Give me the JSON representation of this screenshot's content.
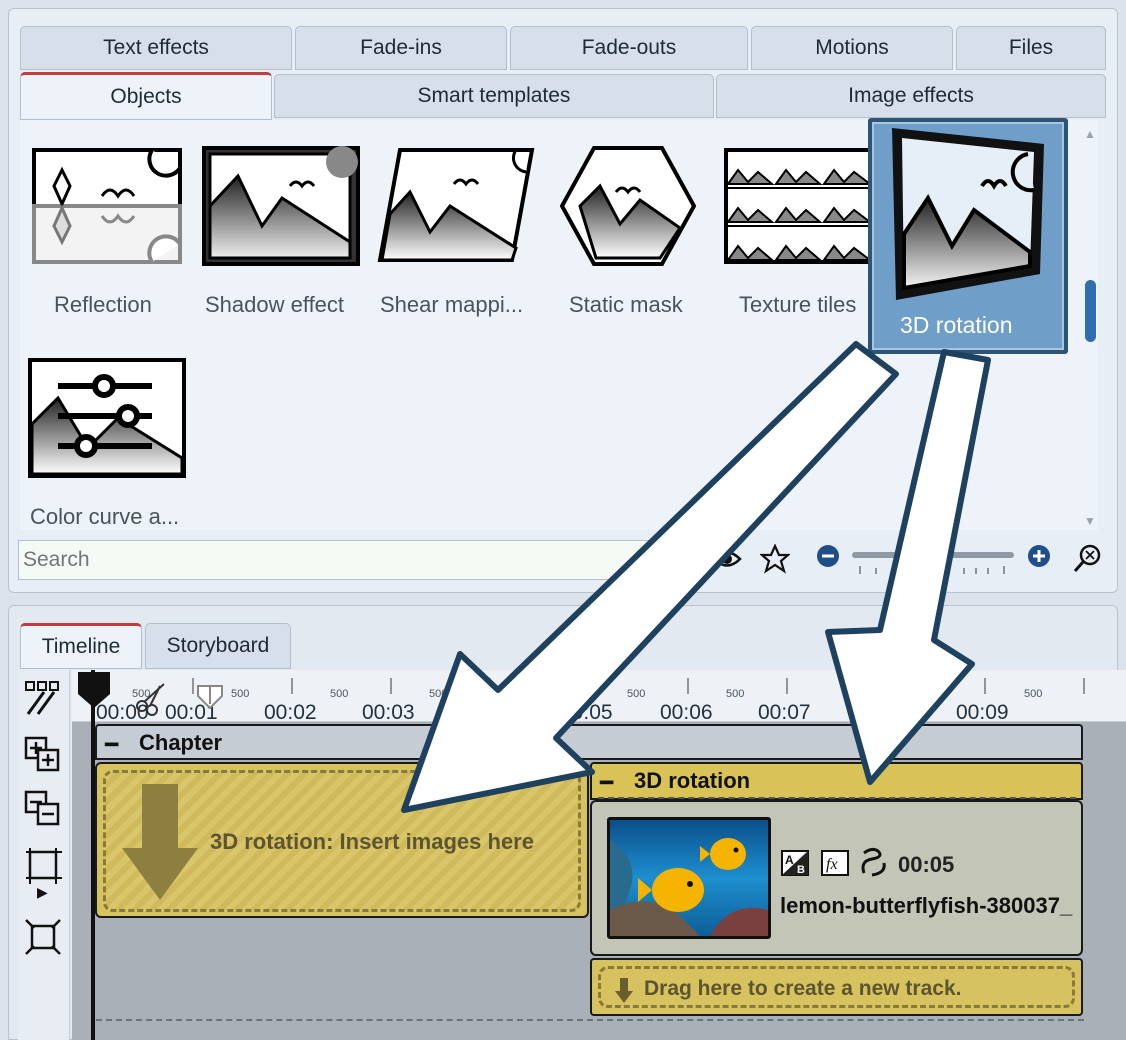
{
  "effect_tabs_row1": [
    "Text effects",
    "Fade-ins",
    "Fade-outs",
    "Motions",
    "Files"
  ],
  "effect_tabs_row2": [
    "Objects",
    "Smart templates",
    "Image effects"
  ],
  "objects": [
    {
      "label": "Reflection",
      "icon": "reflection-icon"
    },
    {
      "label": "Shadow effect",
      "icon": "shadow-effect-icon"
    },
    {
      "label": "Shear mappi...",
      "icon": "shear-mapping-icon"
    },
    {
      "label": "Static mask",
      "icon": "static-mask-icon"
    },
    {
      "label": "Texture tiles",
      "icon": "texture-tiles-icon"
    },
    {
      "label": "3D rotation",
      "icon": "3d-rotation-icon",
      "selected": true
    },
    {
      "label": "Color curve a...",
      "icon": "color-curve-icon"
    }
  ],
  "search": {
    "placeholder": "Search"
  },
  "view_tabs": [
    "Timeline",
    "Storyboard"
  ],
  "ruler": {
    "labels": [
      "00:00",
      "00:01",
      "00:02",
      "00:03",
      "00:05",
      "00:06",
      "00:07",
      "00:09"
    ],
    "half_label": "500"
  },
  "timeline": {
    "chapter_label": "Chapter",
    "drop_zone_text": "3D rotation: Insert images here",
    "effect_header": "3D rotation",
    "clip": {
      "duration": "00:05",
      "filename": "lemon-butterflyfish-380037_"
    },
    "new_track_text": "Drag here to create a new track."
  },
  "colors": {
    "accent_tab": "#c43c3c",
    "selected_tile": "#6f9fc9",
    "effect_yellow": "#d9c356",
    "arrow_outline": "#1f4160"
  }
}
